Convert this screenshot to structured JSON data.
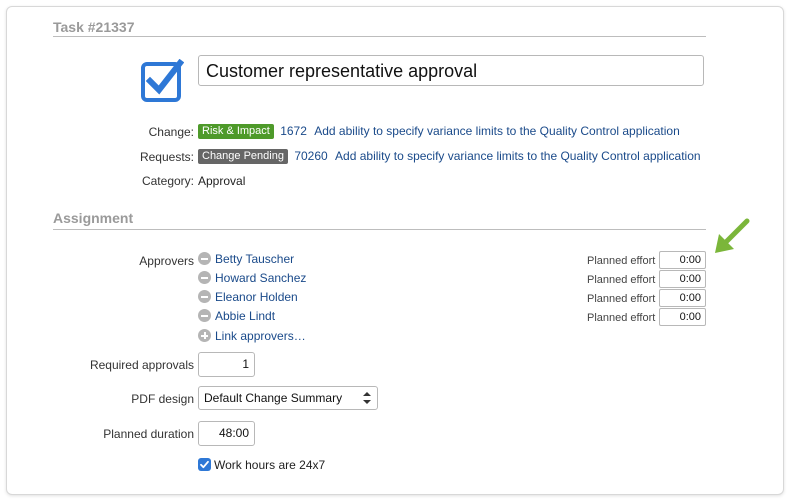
{
  "task": {
    "header": "Task #21337",
    "title": "Customer representative approval",
    "icon": "checkbox-checked-icon"
  },
  "change": {
    "label": "Change:",
    "badge": "Risk & Impact",
    "badge_color": "#4e9a2a",
    "number": "1672",
    "text": "Add ability to specify variance limits to the Quality Control application"
  },
  "requests": {
    "label": "Requests:",
    "badge": "Change Pending",
    "badge_color": "#666666",
    "number": "70260",
    "text": "Add ability to specify variance limits to the Quality Control application"
  },
  "category": {
    "label": "Category:",
    "value": "Approval"
  },
  "assignment": {
    "header": "Assignment",
    "approvers_label": "Approvers",
    "approvers": [
      {
        "name": "Betty Tauscher",
        "effort_label": "Planned effort",
        "effort": "0:00"
      },
      {
        "name": "Howard Sanchez",
        "effort_label": "Planned effort",
        "effort": "0:00"
      },
      {
        "name": "Eleanor Holden",
        "effort_label": "Planned effort",
        "effort": "0:00"
      },
      {
        "name": "Abbie Lindt",
        "effort_label": "Planned effort",
        "effort": "0:00"
      }
    ],
    "link_approvers": "Link approvers…",
    "required_approvals_label": "Required approvals",
    "required_approvals": "1",
    "pdf_design_label": "PDF design",
    "pdf_design": "Default Change Summary",
    "planned_duration_label": "Planned duration",
    "planned_duration": "48:00",
    "work_hours_label": "Work hours are 24x7",
    "work_hours_checked": true
  },
  "colors": {
    "link": "#1a4a8a",
    "accent_blue": "#2e78d6",
    "annotation_arrow": "#7bb63a"
  }
}
